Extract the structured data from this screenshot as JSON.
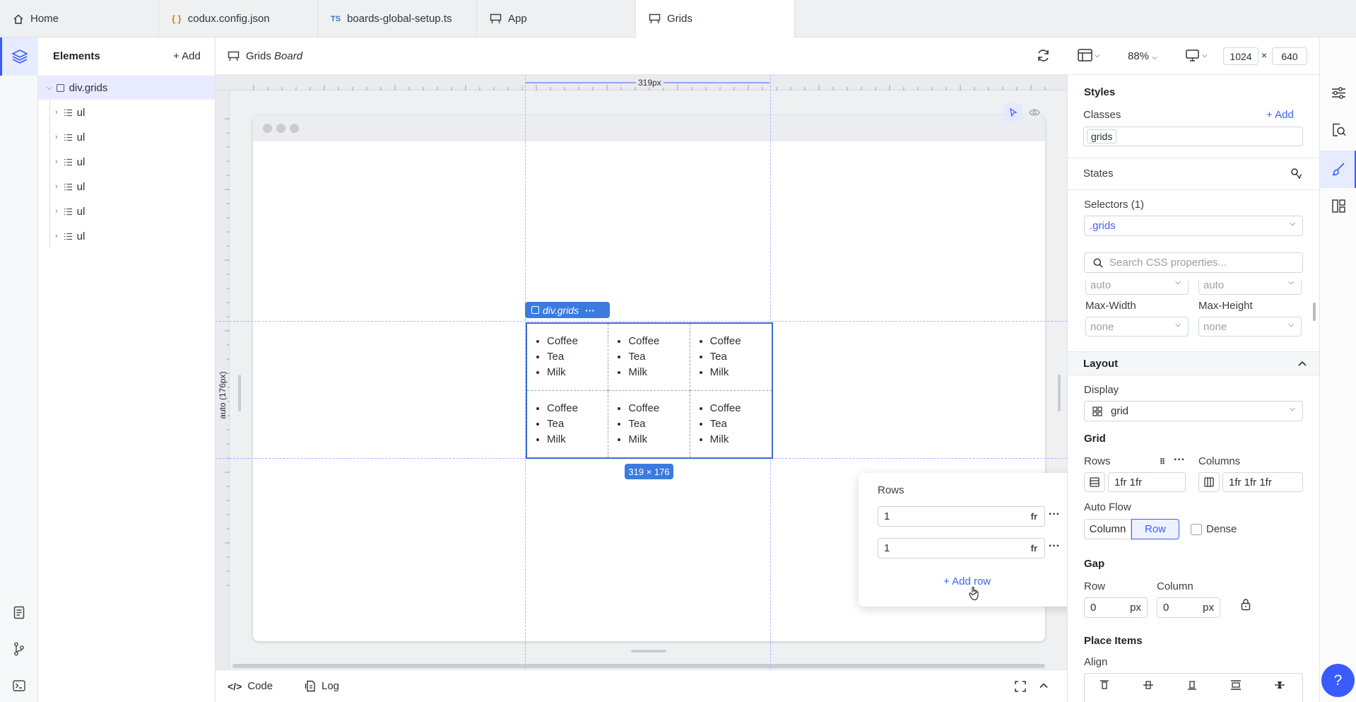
{
  "tabs": [
    {
      "label": "Home",
      "icon": "home-icon"
    },
    {
      "label": "codux.config.json",
      "icon": "braces-icon"
    },
    {
      "label": "boards-global-setup.ts",
      "icon": "ts-icon"
    },
    {
      "label": "App",
      "icon": "board-icon"
    },
    {
      "label": "Grids",
      "icon": "board-icon"
    }
  ],
  "elements_panel": {
    "title": "Elements",
    "add_label": "+ Add",
    "root": "div.grids",
    "children": [
      "ul",
      "ul",
      "ul",
      "ul",
      "ul",
      "ul"
    ]
  },
  "toolbar": {
    "board_name": "Grids",
    "board_suffix": "Board",
    "zoom": "88%",
    "width": "1024",
    "times": "×",
    "height": "640"
  },
  "canvas": {
    "ruler_width_label": "319px",
    "ruler_height_label": "auto (176px)",
    "selection_label": "div.grids",
    "selection_more": "···",
    "size_badge": "319 × 176",
    "list_items": [
      "Coffee",
      "Tea",
      "Milk"
    ]
  },
  "rows_popup": {
    "title": "Rows",
    "rows": [
      {
        "value": "1",
        "unit": "fr"
      },
      {
        "value": "1",
        "unit": "fr"
      }
    ],
    "add_row_label": "+ Add row"
  },
  "bottom_bar": {
    "code_label": "Code",
    "log_label": "Log"
  },
  "styles": {
    "title": "Styles",
    "classes_label": "Classes",
    "add_label": "+ Add",
    "class_chip": "grids",
    "states_label": "States",
    "selectors_label": "Selectors (1)",
    "selector_value": ".grids",
    "search_placeholder": "Search CSS properties...",
    "partial_value_1": "auto",
    "partial_value_2": "auto",
    "max_width_label": "Max-Width",
    "max_height_label": "Max-Height",
    "max_width_value": "none",
    "max_height_value": "none",
    "layout_label": "Layout",
    "display_label": "Display",
    "display_value": "grid",
    "grid_label": "Grid",
    "rows_label": "Rows",
    "columns_label": "Columns",
    "rows_value": "1fr 1fr",
    "columns_value": "1fr 1fr 1fr",
    "auto_flow_label": "Auto Flow",
    "auto_flow_options": [
      "Column",
      "Row"
    ],
    "auto_flow_selected": "Row",
    "dense_label": "Dense",
    "gap_label": "Gap",
    "gap_row_label": "Row",
    "gap_column_label": "Column",
    "gap_row_value": "0",
    "gap_column_value": "0",
    "gap_unit": "px",
    "place_items_label": "Place Items",
    "align_label": "Align"
  },
  "help_label": "?",
  "colors": {
    "accent": "#3b62ff",
    "selection": "#3b7be0",
    "rail_active": "#e7ebff"
  }
}
